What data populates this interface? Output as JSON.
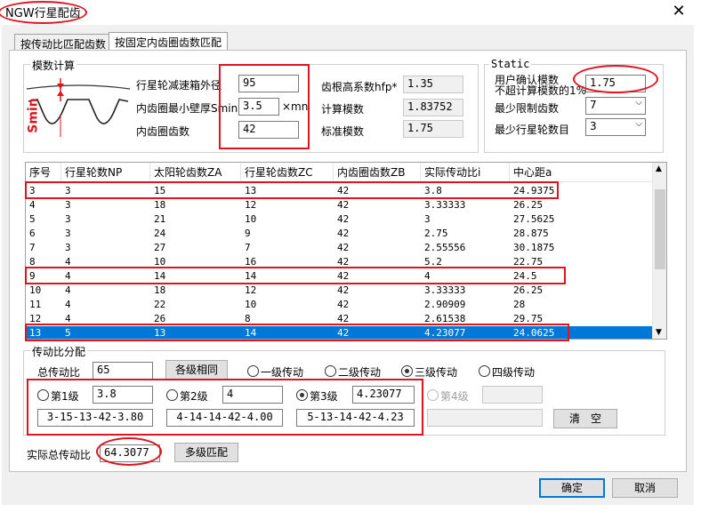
{
  "window": {
    "title": "NGW行星配齿",
    "close_glyph": "✕"
  },
  "tabs": [
    {
      "label": "按传动比匹配齿数"
    },
    {
      "label": "按固定内齿圈齿数匹配"
    }
  ],
  "modulus_group": {
    "title": "模数计算",
    "smin_label": "Smin",
    "fields": [
      {
        "label": "行星轮减速箱外径",
        "value": "95"
      },
      {
        "label": "内齿圈最小壁厚Smin",
        "value": "3.5",
        "unit": "×mn"
      },
      {
        "label": "内齿圈齿数",
        "value": "42"
      }
    ],
    "readonly": [
      {
        "label": "齿根高系数hfp*",
        "value": "1.35"
      },
      {
        "label": "计算模数",
        "value": "1.83752"
      },
      {
        "label": "标准模数",
        "value": "1.75"
      }
    ]
  },
  "static_group": {
    "title": "Static",
    "user_modulus_label_1": "用户确认模数",
    "user_modulus_label_2": "不超计算模数的1%",
    "user_modulus_value": "1.75",
    "min_limit_label": "最少限制齿数",
    "min_limit_value": "7",
    "min_planet_label": "最少行星轮数目",
    "min_planet_value": "3"
  },
  "table": {
    "columns": [
      "序号",
      "行星轮数NP",
      "太阳轮齿数ZA",
      "行星轮齿数ZC",
      "内齿圈齿数ZB",
      "实际传动比i",
      "中心距a"
    ],
    "rows": [
      [
        "3",
        "3",
        "15",
        "13",
        "42",
        "3.8",
        "24.9375"
      ],
      [
        "4",
        "3",
        "18",
        "12",
        "42",
        "3.33333",
        "26.25"
      ],
      [
        "5",
        "3",
        "21",
        "10",
        "42",
        "3",
        "27.5625"
      ],
      [
        "6",
        "3",
        "24",
        "9",
        "42",
        "2.75",
        "28.875"
      ],
      [
        "7",
        "3",
        "27",
        "7",
        "42",
        "2.55556",
        "30.1875"
      ],
      [
        "8",
        "4",
        "10",
        "16",
        "42",
        "5.2",
        "22.75"
      ],
      [
        "9",
        "4",
        "14",
        "14",
        "42",
        "4",
        "24.5"
      ],
      [
        "10",
        "4",
        "18",
        "12",
        "42",
        "3.33333",
        "26.25"
      ],
      [
        "11",
        "4",
        "22",
        "10",
        "42",
        "2.90909",
        "28"
      ],
      [
        "12",
        "4",
        "26",
        "8",
        "42",
        "2.61538",
        "29.75"
      ],
      [
        "13",
        "5",
        "13",
        "14",
        "42",
        "4.23077",
        "24.0625"
      ]
    ]
  },
  "ratio_group": {
    "title": "传动比分配",
    "total_label": "总传动比",
    "total_value": "65",
    "equal_button": "各级相同",
    "stage_options": [
      "一级传动",
      "二级传动",
      "三级传动",
      "四级传动"
    ],
    "stages": [
      {
        "label": "第1级",
        "value": "3.8",
        "combo": "3-15-13-42-3.80"
      },
      {
        "label": "第2级",
        "value": "4",
        "combo": "4-14-14-42-4.00"
      },
      {
        "label": "第3级",
        "value": "4.23077",
        "combo": "5-13-14-42-4.23"
      },
      {
        "label": "第4级",
        "value": "",
        "combo": ""
      }
    ],
    "clear_button": "清　空"
  },
  "actual_total_label": "实际总传动比",
  "actual_total_value": "64.3077",
  "match_button": "多级匹配",
  "ok_button": "确定",
  "cancel_button": "取消",
  "colors": {
    "selection": "#0078d7",
    "annotation": "#e0141e"
  }
}
